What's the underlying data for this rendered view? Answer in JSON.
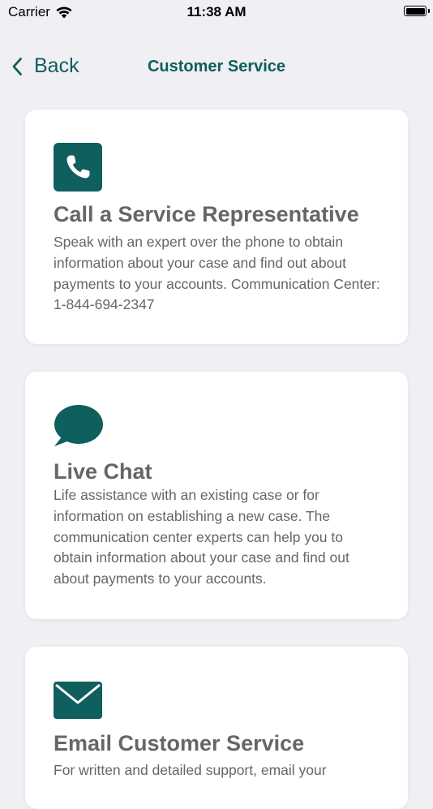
{
  "status_bar": {
    "carrier": "Carrier",
    "time": "11:38 AM"
  },
  "nav": {
    "back_label": "Back",
    "title": "Customer Service"
  },
  "accent_color": "#0e5f5d",
  "cards": [
    {
      "icon": "phone-icon",
      "title": "Call a Service Representative",
      "description": "Speak with an expert over the phone to obtain information about your case and find out about payments to your accounts. Communication Center: 1-844-694-2347"
    },
    {
      "icon": "chat-bubble-icon",
      "title": "Live Chat",
      "description": "Life assistance with an existing case or for information on establishing a new case. The communication center experts can help you to obtain information about your case and find out about payments to your accounts."
    },
    {
      "icon": "envelope-icon",
      "title": "Email Customer Service",
      "description": "For written and detailed support, email your"
    }
  ]
}
